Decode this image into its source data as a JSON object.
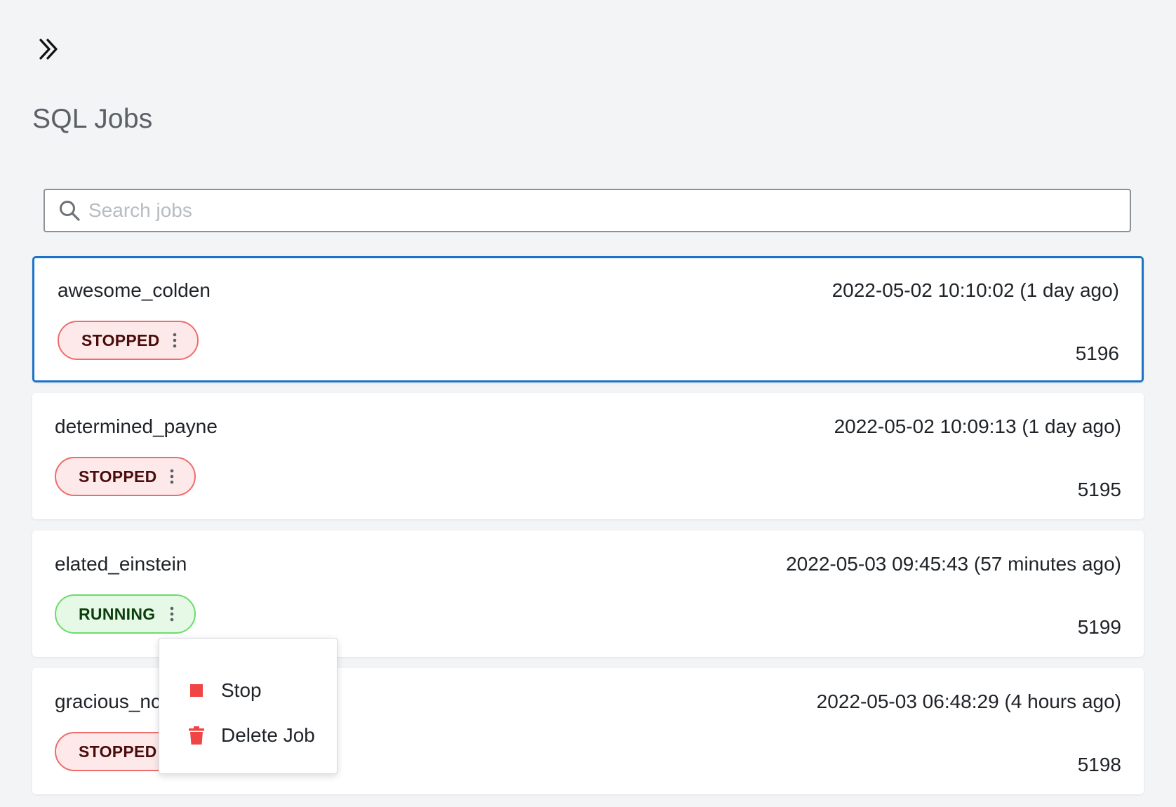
{
  "header": {
    "expand_icon": "double-chevron-right-icon",
    "title": "SQL Jobs"
  },
  "search": {
    "placeholder": "Search jobs",
    "value": "",
    "icon": "search-icon"
  },
  "colors": {
    "selected_border": "#1a73c9",
    "stopped_bg": "#fde9e9",
    "stopped_border": "#f16b6b",
    "running_bg": "#e6f9e6",
    "running_border": "#6bdc6b",
    "menu_icon": "#f04545"
  },
  "jobs": [
    {
      "name": "awesome_colden",
      "timestamp": "2022-05-02 10:10:02 (1 day ago)",
      "status": "STOPPED",
      "id": "5196",
      "selected": true
    },
    {
      "name": "determined_payne",
      "timestamp": "2022-05-02 10:09:13 (1 day ago)",
      "status": "STOPPED",
      "id": "5195",
      "selected": false
    },
    {
      "name": "elated_einstein",
      "timestamp": "2022-05-03 09:45:43 (57 minutes ago)",
      "status": "RUNNING",
      "id": "5199",
      "selected": false
    },
    {
      "name": "gracious_nc",
      "timestamp": "2022-05-03 06:48:29 (4 hours ago)",
      "status": "STOPPED",
      "id": "5198",
      "selected": false
    }
  ],
  "context_menu": {
    "items": [
      {
        "label": "Stop",
        "icon": "stop-square-icon"
      },
      {
        "label": "Delete Job",
        "icon": "trash-icon"
      }
    ]
  }
}
